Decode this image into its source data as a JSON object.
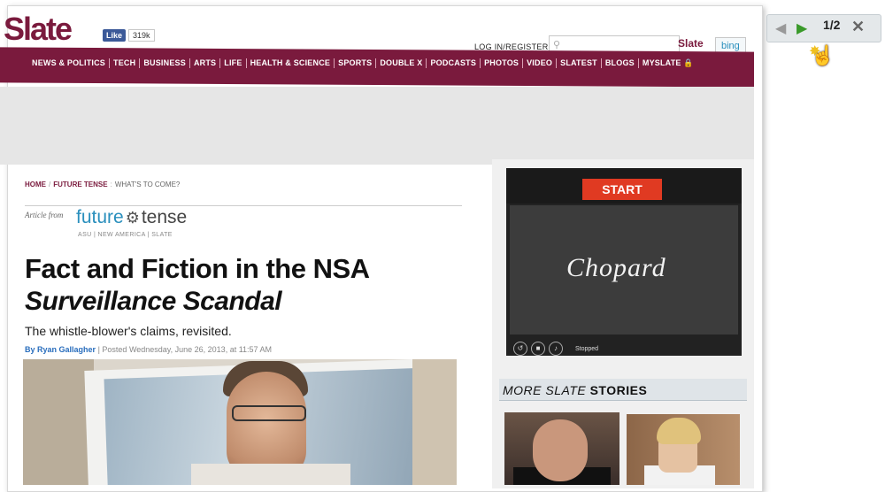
{
  "header": {
    "logo": "Slate",
    "fb_like": "Like",
    "fb_count": "319k",
    "login": "LOG IN/REGISTER",
    "search_placeholder": "",
    "search_slate": "Slate",
    "search_bing": "bing"
  },
  "nav": {
    "items": [
      "NEWS & POLITICS",
      "TECH",
      "BUSINESS",
      "ARTS",
      "LIFE",
      "HEALTH & SCIENCE",
      "SPORTS",
      "DOUBLE X",
      "PODCASTS",
      "PHOTOS",
      "VIDEO",
      "SLATEST",
      "BLOGS",
      "MYSLATE"
    ]
  },
  "breadcrumb": {
    "home": "HOME",
    "section": "FUTURE TENSE",
    "tagline": "WHAT'S TO COME?"
  },
  "brand": {
    "article_from": "Article from",
    "future": "future",
    "tense": "tense",
    "sub": "ASU | NEW AMERICA | SLATE"
  },
  "article": {
    "headline_line1": "Fact and Fiction in the NSA",
    "headline_line2": "Surveillance Scandal",
    "dek": "The whistle-blower's claims, revisited.",
    "by": "By",
    "author": "Ryan Gallagher",
    "posted": "Posted Wednesday, June 26, 2013, at 11:57 AM"
  },
  "ad": {
    "start": "START",
    "brand": "Chopard",
    "control_label": "Stopped"
  },
  "more": {
    "prefix": "MORE SLATE",
    "word": "STORIES"
  },
  "viewer": {
    "page": "1/2"
  },
  "colors": {
    "brand": "#7a1a3d",
    "link": "#2a6ebd",
    "start": "#e03a22"
  },
  "icons": {
    "prev": "arrow-left-icon",
    "next": "arrow-right-icon",
    "close": "close-icon",
    "cursor": "hand-pointer-icon",
    "search": "search-icon",
    "lock": "lock-icon"
  }
}
